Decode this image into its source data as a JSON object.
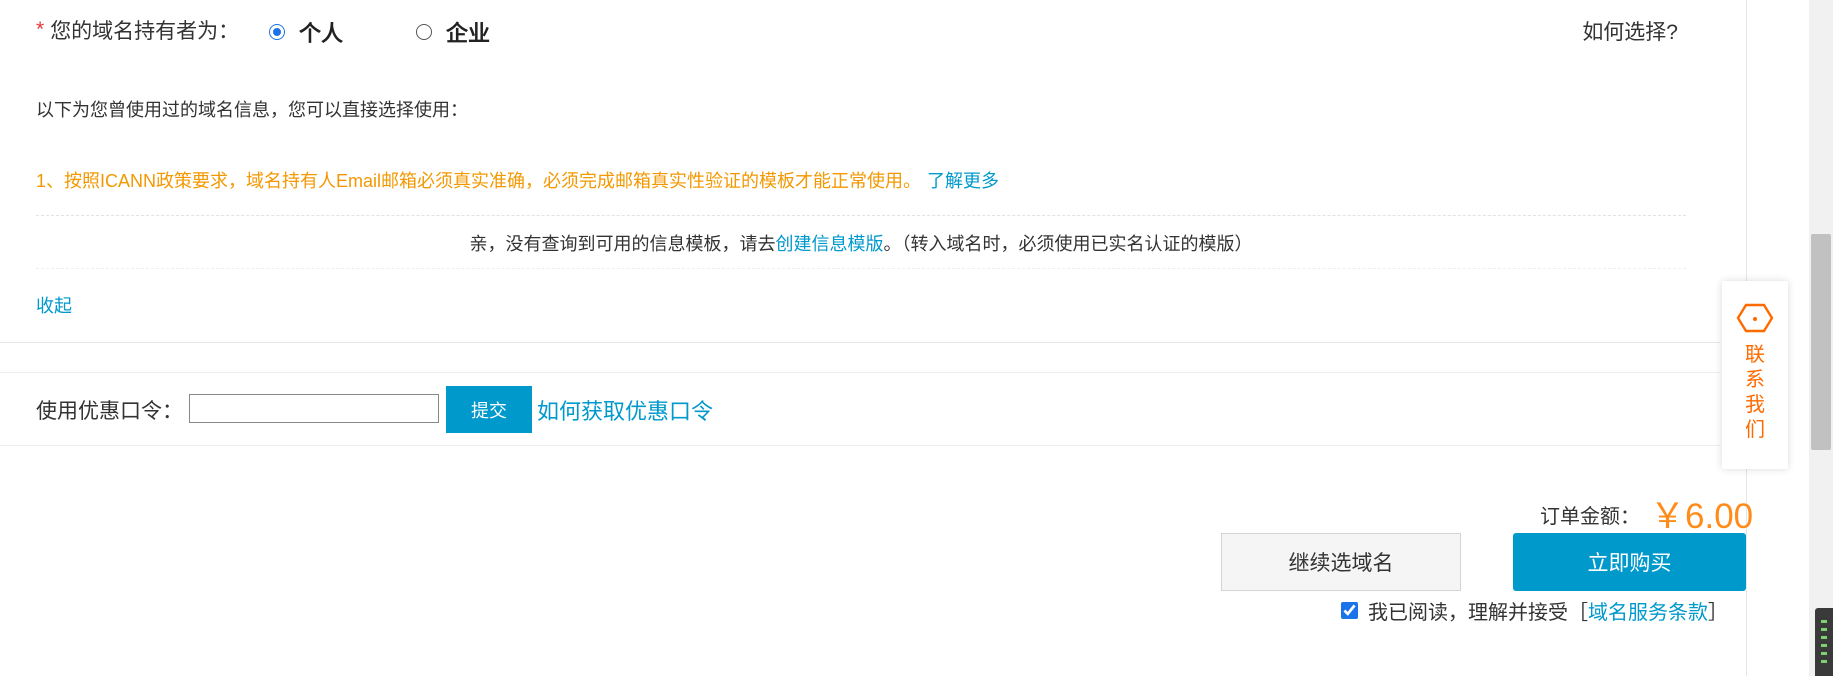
{
  "owner": {
    "required_mark": "*",
    "label": "您的域名持有者为：",
    "options": [
      {
        "label": "个人",
        "selected": true
      },
      {
        "label": "企业",
        "selected": false
      }
    ],
    "how_to_choose": "如何选择?"
  },
  "template_section": {
    "used_info": "以下为您曾使用过的域名信息，您可以直接选择使用：",
    "notice_text": "1、按照ICANN政策要求，域名持有人Email邮箱必须真实准确，必须完成邮箱真实性验证的模板才能正常使用。",
    "notice_link": "了解更多",
    "empty_prefix": "亲，没有查询到可用的信息模板，请去",
    "empty_link": "创建信息模版",
    "empty_suffix": "。（转入域名时，必须使用已实名认证的模版）",
    "collapse": "收起"
  },
  "coupon": {
    "label": "使用优惠口令：",
    "value": "",
    "submit": "提交",
    "how_link": "如何获取优惠口令"
  },
  "order": {
    "amount_label": "订单金额：",
    "amount_value": "￥6.00",
    "continue_button": "继续选域名",
    "buy_button": "立即购买",
    "agree_checked": true,
    "agree_prefix": "我已阅读，理解并接受［",
    "agree_link": "域名服务条款",
    "agree_suffix": "］"
  },
  "contact": {
    "label": "联系我们",
    "icon": "cube-chat-icon"
  },
  "colors": {
    "accent": "#0099cc",
    "notice": "#f39800",
    "price": "#ff8c1a",
    "contact": "#ff6a00"
  }
}
